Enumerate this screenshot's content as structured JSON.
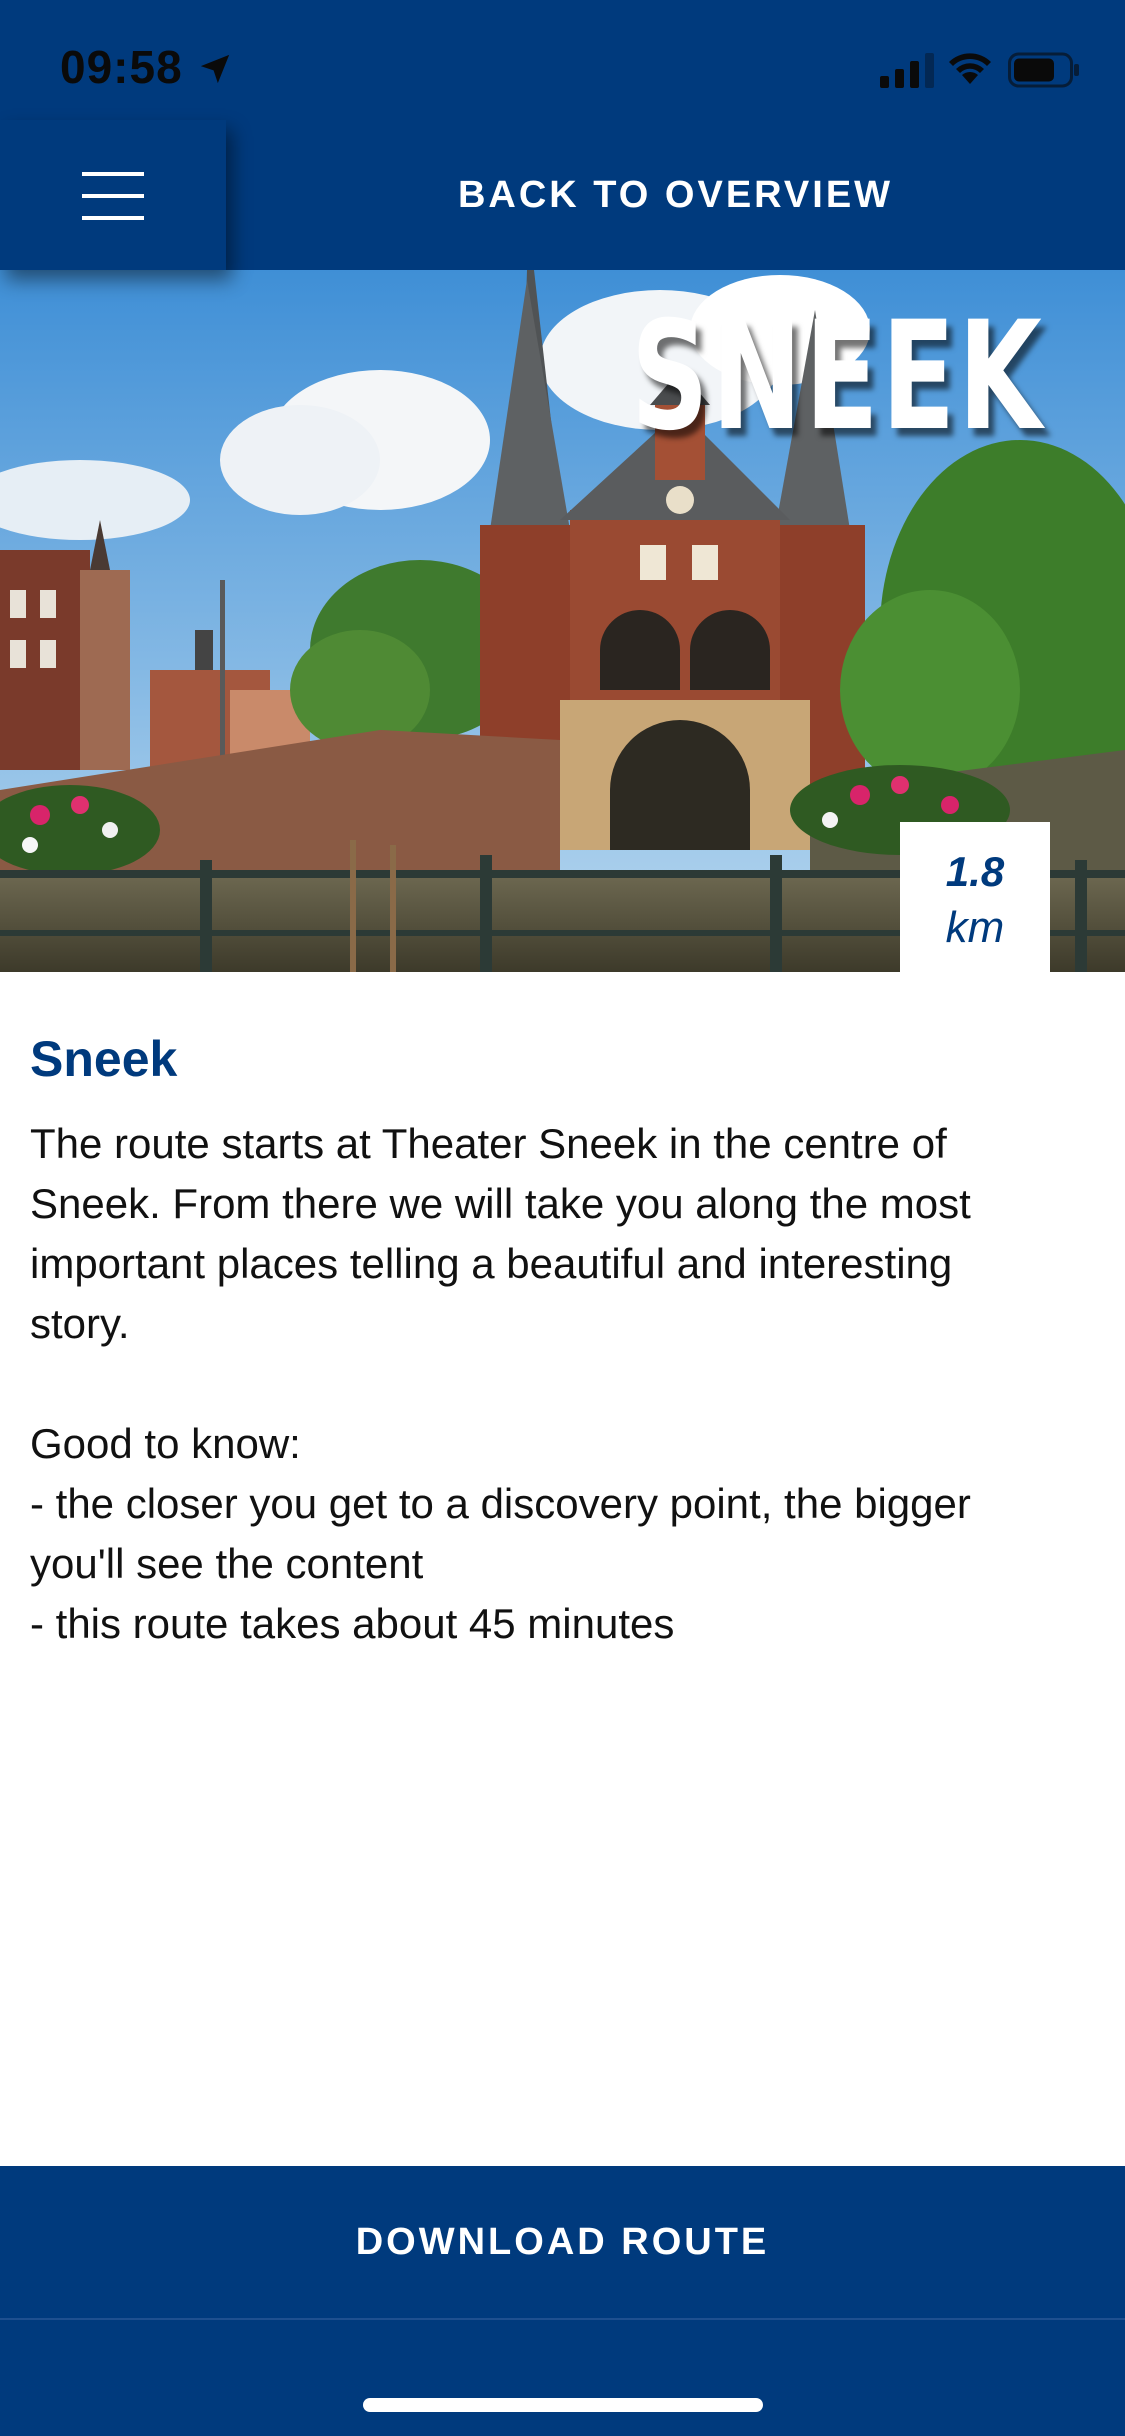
{
  "status_bar": {
    "time": "09:58",
    "icons": [
      "location-arrow-icon",
      "cellular-signal-icon",
      "wifi-icon",
      "battery-icon"
    ]
  },
  "header": {
    "menu_icon": "hamburger-menu-icon",
    "back_label": "BACK TO OVERVIEW"
  },
  "hero": {
    "title": "SNEEK",
    "distance_value": "1.8",
    "distance_unit": "km"
  },
  "route": {
    "title": "Sneek",
    "description_lines": [
      "The route starts at Theater Sneek in the centre of",
      "Sneek. From there we will take you along the most",
      "important places telling a beautiful and interesting",
      "story."
    ],
    "good_to_know_lines": [
      "Good to know:",
      "- the closer you get to a discovery point, the bigger",
      "you'll see the content",
      "- this route takes about 45 minutes"
    ]
  },
  "footer": {
    "download_label": "DOWNLOAD ROUTE"
  },
  "colors": {
    "brand_blue": "#003a7d",
    "text_dark": "#111111",
    "white": "#ffffff"
  }
}
